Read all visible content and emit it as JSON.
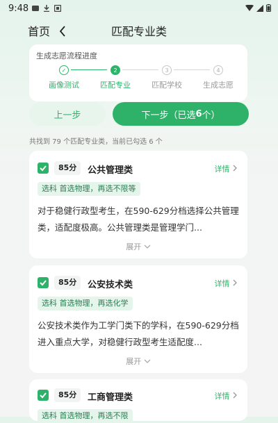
{
  "status_bar": {
    "time": "9:48"
  },
  "nav": {
    "home": "首页",
    "back_icon": "chevron-left",
    "title": "匹配专业类"
  },
  "progress": {
    "label": "生成志愿流程进度",
    "steps": [
      {
        "num": "✓",
        "label": "画像测试",
        "state": "done"
      },
      {
        "num": "2",
        "label": "匹配专业",
        "state": "current"
      },
      {
        "num": "3",
        "label": "匹配学校",
        "state": "todo"
      },
      {
        "num": "4",
        "label": "生成志愿",
        "state": "todo"
      }
    ]
  },
  "buttons": {
    "prev": "上一步",
    "next_prefix": "下一步（已选",
    "next_count": "6",
    "next_suffix": "个）"
  },
  "summary": "共找到 79 个匹配专业类，当前已勾选 6 个",
  "cards": [
    {
      "score": "85分",
      "name": "公共管理类",
      "detail": "详情",
      "subject": "选科 首选物理，再选不限等",
      "desc": "对于稳健行政型考生，在590-629分档选择公共管理类，适配度极高。公共管理类是管理学门...",
      "expand": "展开"
    },
    {
      "score": "85分",
      "name": "公安技术类",
      "detail": "详情",
      "subject": "选科 首选物理，再选化学",
      "desc": "公安技术类作为工学门类下的学科，在590-629分档进入重点大学，对稳健行政型考生适配度...",
      "expand": "展开"
    },
    {
      "score": "85分",
      "name": "工商管理类",
      "detail": "详情",
      "subject": "选科 首选物理，再选不限"
    }
  ],
  "colors": {
    "accent": "#2eb26a",
    "accent_light": "#e6f5ec"
  }
}
